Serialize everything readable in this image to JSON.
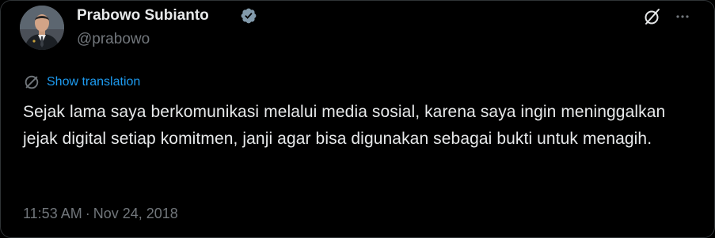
{
  "user": {
    "display_name": "Prabowo Subianto",
    "handle": "@prabowo",
    "verified": true
  },
  "actions": {
    "grok_icon": "slashed-circle-icon",
    "more_icon": "more-horizontal-icon"
  },
  "translation": {
    "label": "Show translation",
    "icon": "globe-icon"
  },
  "tweet": {
    "text": "Sejak lama saya berkomunikasi melalui media sosial, karena saya ingin meninggalkan jejak digital setiap komitmen, janji agar bisa digunakan sebagai bukti untuk menagih."
  },
  "meta": {
    "time": "11:53 AM",
    "separator": "·",
    "date": "Nov 24, 2018"
  },
  "colors": {
    "background": "#000000",
    "text": "#e7e9ea",
    "muted": "#71767b",
    "accent": "#1d9bf0",
    "verified_badge": "#829aab"
  }
}
